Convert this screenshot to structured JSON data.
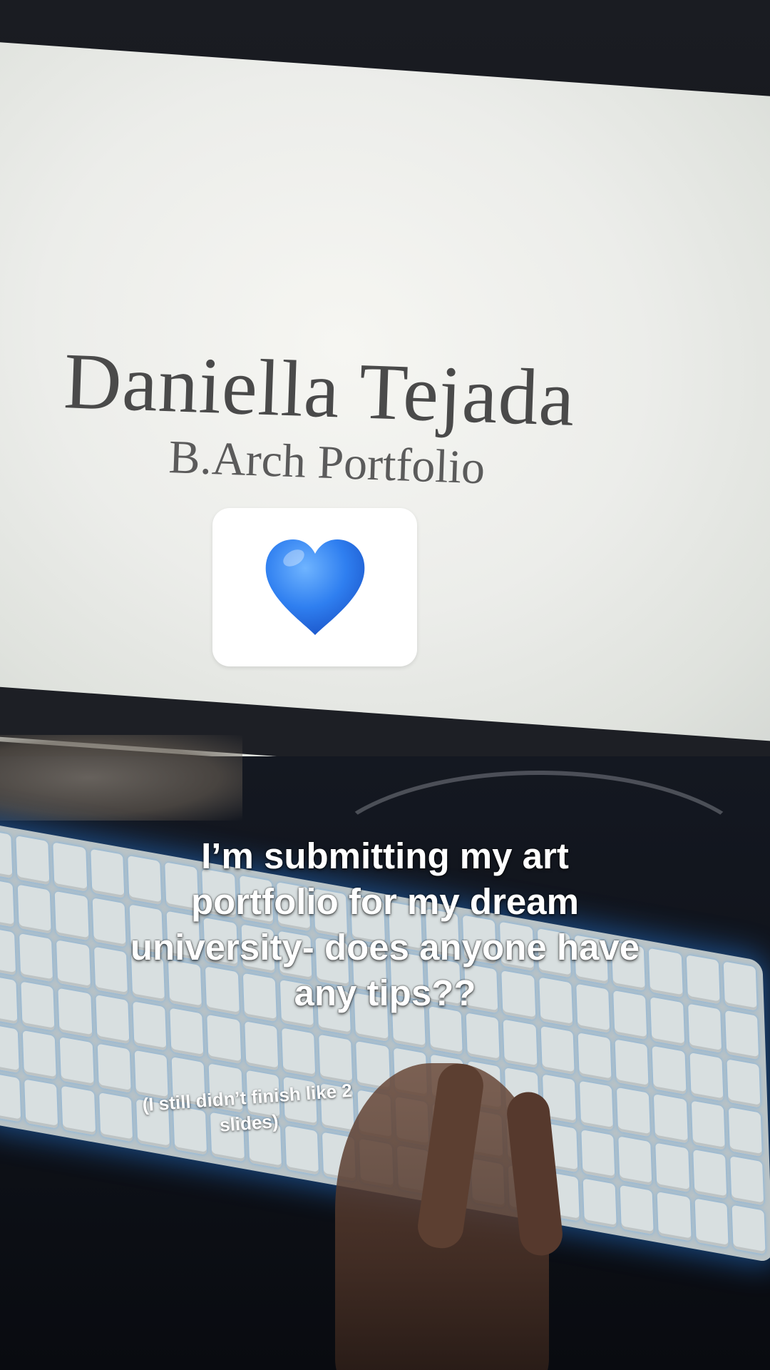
{
  "slide": {
    "name": "Daniella Tejada",
    "subtitle": "B.Arch Portfolio"
  },
  "sticker": {
    "icon": "blue-heart-icon",
    "color": "#2f7ff0"
  },
  "captions": {
    "main": "I’m submitting my art portfolio for my dream university- does anyone have any tips??",
    "note": "(I still didn’t finish like 2 slides)"
  },
  "colors": {
    "keyboard_glow": "#2f8cff",
    "screen": "#eeeeea"
  }
}
